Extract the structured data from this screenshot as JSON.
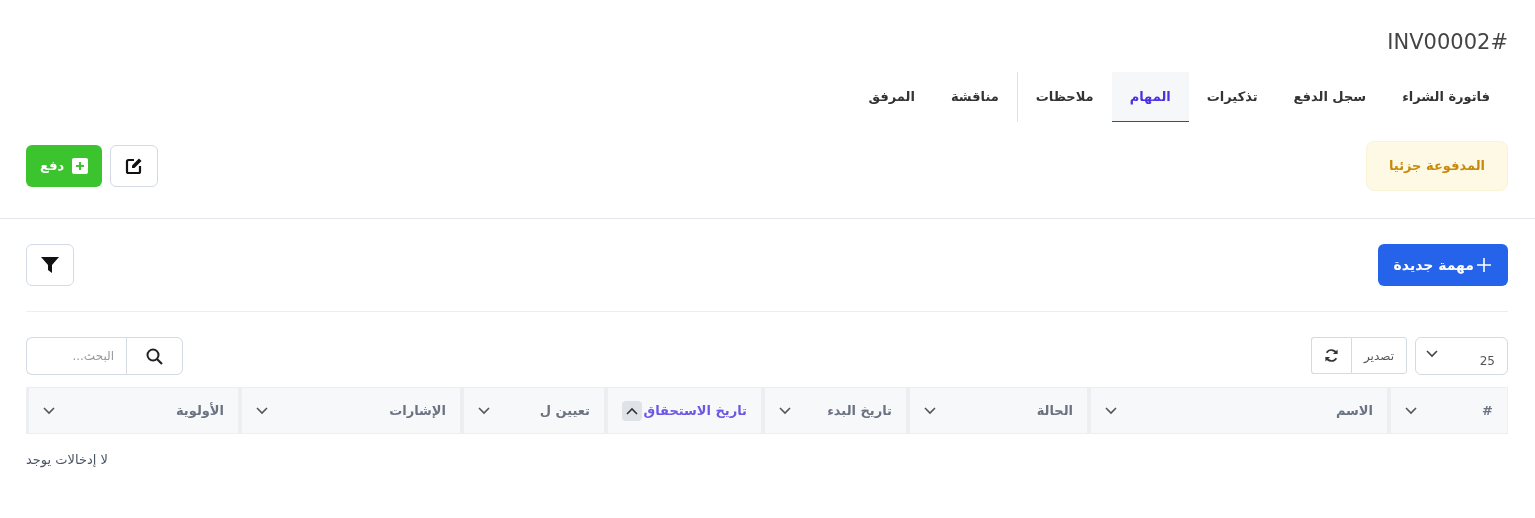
{
  "title": "#INV00002",
  "tab_groups": [
    {
      "tabs": [
        {
          "label": "فاتورة الشراء",
          "selected": false
        },
        {
          "label": "سجل الدفع",
          "selected": false
        },
        {
          "label": "تذكيرات",
          "selected": false
        },
        {
          "label": "المهام",
          "selected": true
        },
        {
          "label": "ملاحظات",
          "selected": false
        }
      ]
    },
    {
      "tabs": [
        {
          "label": "مناقشة",
          "selected": false
        },
        {
          "label": "المرفق",
          "selected": false
        }
      ]
    }
  ],
  "status_badge": "المدفوعة جزئيا",
  "pay_button": "دفع",
  "new_task_button": "مهمة جديدة",
  "page_length": "25",
  "export_button": "تصدير",
  "search": {
    "placeholder": "البحث..."
  },
  "table": {
    "columns": [
      {
        "label": "#",
        "sorted": false
      },
      {
        "label": "الاسم",
        "sorted": false
      },
      {
        "label": "الحالة",
        "sorted": false
      },
      {
        "label": "تاريخ البدء",
        "sorted": false
      },
      {
        "label": "تاريخ الاستحقاق",
        "sorted": true
      },
      {
        "label": "تعيين ل",
        "sorted": false
      },
      {
        "label": "الإشارات",
        "sorted": false
      },
      {
        "label": "الأولوية",
        "sorted": false
      }
    ],
    "empty_message": "لا إدخالات يوجد"
  }
}
